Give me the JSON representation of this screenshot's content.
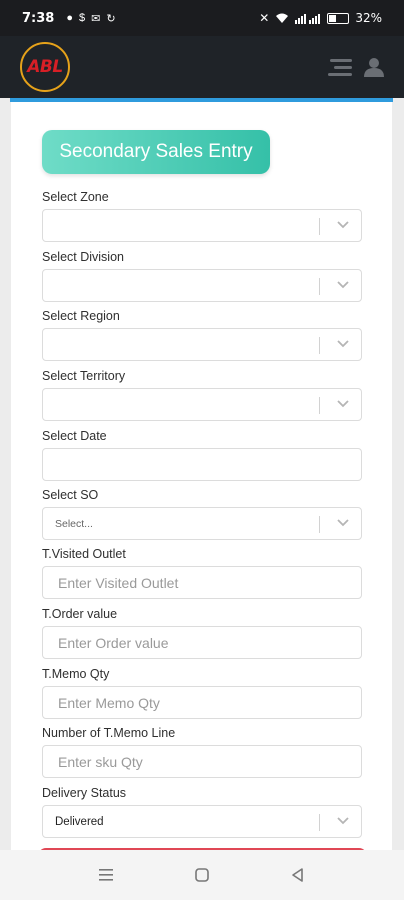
{
  "status_bar": {
    "time": "7:38",
    "battery": "32%",
    "battery_level": 0.32
  },
  "header": {
    "logo_text": "ABL"
  },
  "form": {
    "title": "Secondary Sales Entry",
    "fields": {
      "zone": {
        "label": "Select Zone",
        "value": ""
      },
      "division": {
        "label": "Select Division",
        "value": ""
      },
      "region": {
        "label": "Select Region",
        "value": ""
      },
      "territory": {
        "label": "Select Territory",
        "value": ""
      },
      "date": {
        "label": "Select Date",
        "value": ""
      },
      "so": {
        "label": "Select SO",
        "value": "Select..."
      },
      "visited_outlet": {
        "label": "T.Visited Outlet",
        "placeholder": "Enter Visited Outlet"
      },
      "order_value": {
        "label": "T.Order value",
        "placeholder": "Enter Order value"
      },
      "memo_qty": {
        "label": "T.Memo Qty",
        "placeholder": "Enter Memo Qty"
      },
      "memo_line": {
        "label": "Number of T.Memo Line",
        "placeholder": "Enter sku Qty"
      },
      "delivery_status": {
        "label": "Delivery Status",
        "value": "Delivered"
      }
    }
  },
  "colors": {
    "title_gradient_start": "#6fdcc7",
    "title_gradient_end": "#35c0a8",
    "accent_blue": "#2f9bdd",
    "submit_red": "#e04755"
  },
  "icons": [
    "chevron-down-icon",
    "hamburger-menu-icon",
    "user-icon",
    "wifi-icon",
    "signal-icon",
    "battery-icon",
    "nav-menu-icon",
    "nav-home-icon",
    "nav-back-icon"
  ]
}
